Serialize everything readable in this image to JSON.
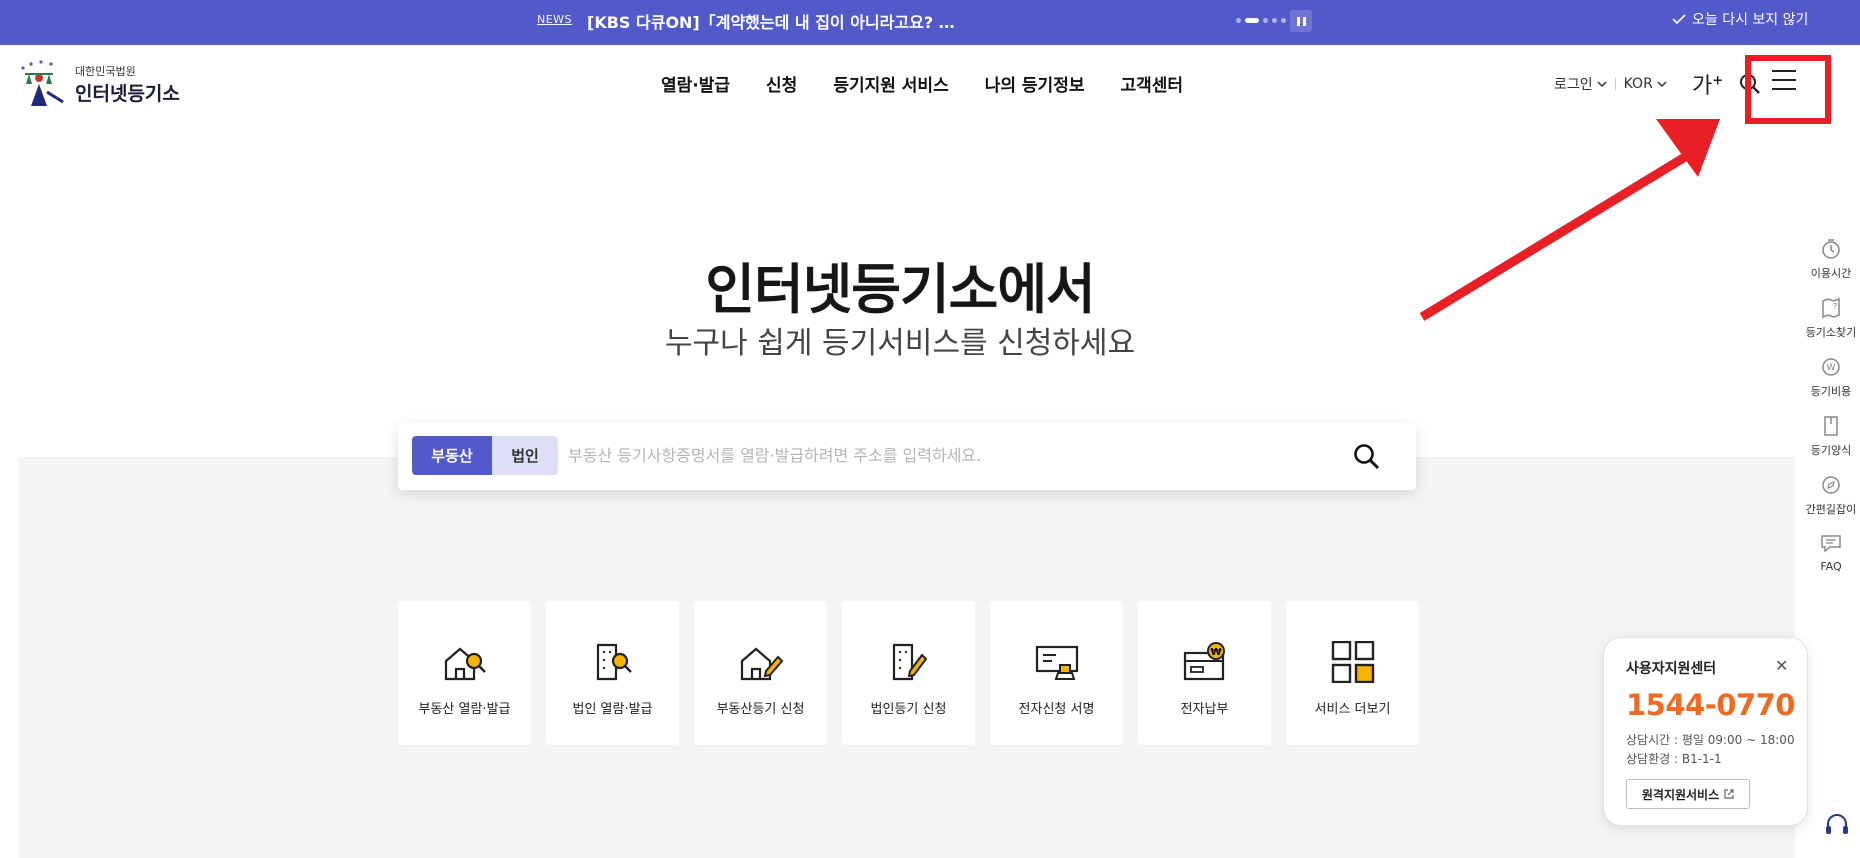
{
  "news": {
    "tag": "NEWS",
    "text": "[KBS 다큐ON]「계약했는데 내 집이 아니라고요? …",
    "dismiss": "오늘 다시 보지 않기"
  },
  "header": {
    "logo_small": "대한민국법원",
    "logo_big": "인터넷등기소",
    "nav": [
      "열람·발급",
      "신청",
      "등기지원 서비스",
      "나의 등기정보",
      "고객센터"
    ],
    "login": "로그인",
    "lang": "KOR",
    "font_size": "가"
  },
  "hero": {
    "title": "인터넷등기소에서",
    "subtitle": "누구나 쉽게 등기서비스를 신청하세요"
  },
  "search": {
    "tab_realestate": "부동산",
    "tab_corp": "법인",
    "placeholder": "부동산 등기사항증명서를 열람·발급하려면 주소를 입력하세요."
  },
  "services": [
    {
      "label": "부동산 열람·발급",
      "icon": "house-search-icon"
    },
    {
      "label": "법인 열람·발급",
      "icon": "building-search-icon"
    },
    {
      "label": "부동산등기 신청",
      "icon": "house-pen-icon"
    },
    {
      "label": "법인등기 신청",
      "icon": "building-pen-icon"
    },
    {
      "label": "전자신청 서명",
      "icon": "signature-stamp-icon"
    },
    {
      "label": "전자납부",
      "icon": "wallet-won-icon"
    },
    {
      "label": "서비스 더보기",
      "icon": "grid-more-icon"
    }
  ],
  "quick_menu": [
    "이용시간",
    "등기소찾기",
    "등기비용",
    "등기양식",
    "간편길잡이",
    "FAQ"
  ],
  "support": {
    "title": "사용자지원센터",
    "phone": "1544-0770",
    "hours": "상담시간 : 평일 09:00 ~ 18:00",
    "env": "상담환경 : B1-1-1",
    "remote_button": "원격지원서비스"
  },
  "colors": {
    "brand": "#5259c8",
    "accent_orange": "#f06a22",
    "annotation_red": "#e81f24"
  }
}
